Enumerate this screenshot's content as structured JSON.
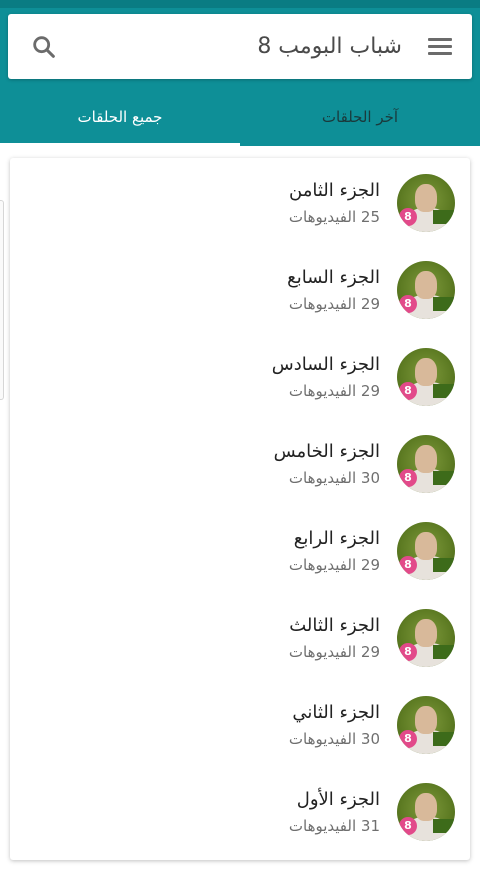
{
  "header": {
    "search_text": "شباب البومب 8",
    "accent_color": "#0e8f97"
  },
  "tabs": [
    {
      "label": "جميع الحلقات",
      "active": true
    },
    {
      "label": "آخر الحلقات",
      "active": false
    }
  ],
  "list": {
    "items": [
      {
        "title": "الجزء الثامن",
        "subtitle": "25 الفيديوهات",
        "badge": "8"
      },
      {
        "title": "الجزء السابع",
        "subtitle": "29 الفيديوهات",
        "badge": "8"
      },
      {
        "title": "الجزء السادس",
        "subtitle": "29 الفيديوهات",
        "badge": "8"
      },
      {
        "title": "الجزء الخامس",
        "subtitle": "30 الفيديوهات",
        "badge": "8"
      },
      {
        "title": "الجزء الرابع",
        "subtitle": "29 الفيديوهات",
        "badge": "8"
      },
      {
        "title": "الجزء الثالث",
        "subtitle": "29 الفيديوهات",
        "badge": "8"
      },
      {
        "title": "الجزء الثاني",
        "subtitle": "30 الفيديوهات",
        "badge": "8"
      },
      {
        "title": "الجزء الأول",
        "subtitle": "31 الفيديوهات",
        "badge": "8"
      }
    ]
  }
}
